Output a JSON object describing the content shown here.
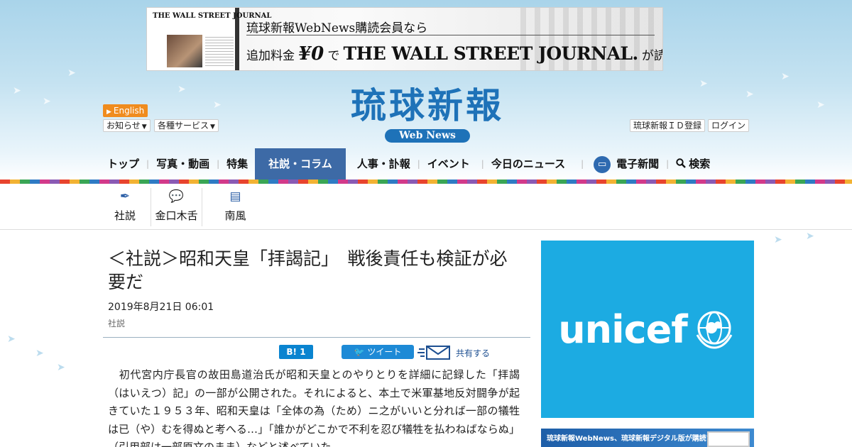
{
  "banner": {
    "wsj_mini": "THE WALL STREET JOURNAL",
    "line1": "琉球新報WebNews購読会員なら",
    "line2_prefix": "追加料金",
    "line2_yen": "¥0",
    "line2_de": "で",
    "line2_wsj": "THE WALL STREET JOURNAL.",
    "line2_suffix": "が読める"
  },
  "header": {
    "lang_label": "English",
    "notice_label": "お知らせ",
    "services_label": "各種サービス",
    "logo_kanji": "琉球新報",
    "logo_sub": "Web News",
    "register_label": "琉球新報ＩＤ登録",
    "login_label": "ログイン"
  },
  "nav": {
    "items": [
      "トップ",
      "写真・動画",
      "特集",
      "社説・コラム",
      "人事・訃報",
      "イベント",
      "今日のニュース"
    ],
    "enews_label": "電子新聞",
    "search_label": "検索"
  },
  "subnav": {
    "items": [
      "社説",
      "金口木舌",
      "南風"
    ]
  },
  "article": {
    "title": "＜社説＞昭和天皇「拝謁記」　戦後責任も検証が必要だ",
    "date": "2019年8月21日 06:01",
    "category": "社説",
    "hatena_count": "1",
    "tweet_label": "ツイート",
    "share_label": "共有する",
    "body": "　初代宮内庁長官の故田島道治氏が昭和天皇とのやりとりを詳細に記録した「拝謁（はいえつ）記」の一部が公開された。それによると、本土で米軍基地反対闘争が起きていた１９５３年、昭和天皇は「全体の為（ため）ニ之がいいと分れば一部の犠牲は已（や）むを得ぬと考へる…」「誰かがどこかで不利を忍び犠牲を払わねばならぬ」（引用部は一部原文のまま）などと述べていた。"
  },
  "sidebar": {
    "ad_word": "unicef",
    "promo_text": "琉球新報WebNews、琉球新報デジタル版が購読できる"
  },
  "colors": {
    "brand_blue": "#1e72b8",
    "nav_active": "#3d6aa6",
    "english_orange": "#f08c1e",
    "unicef_blue": "#1cabe2"
  }
}
